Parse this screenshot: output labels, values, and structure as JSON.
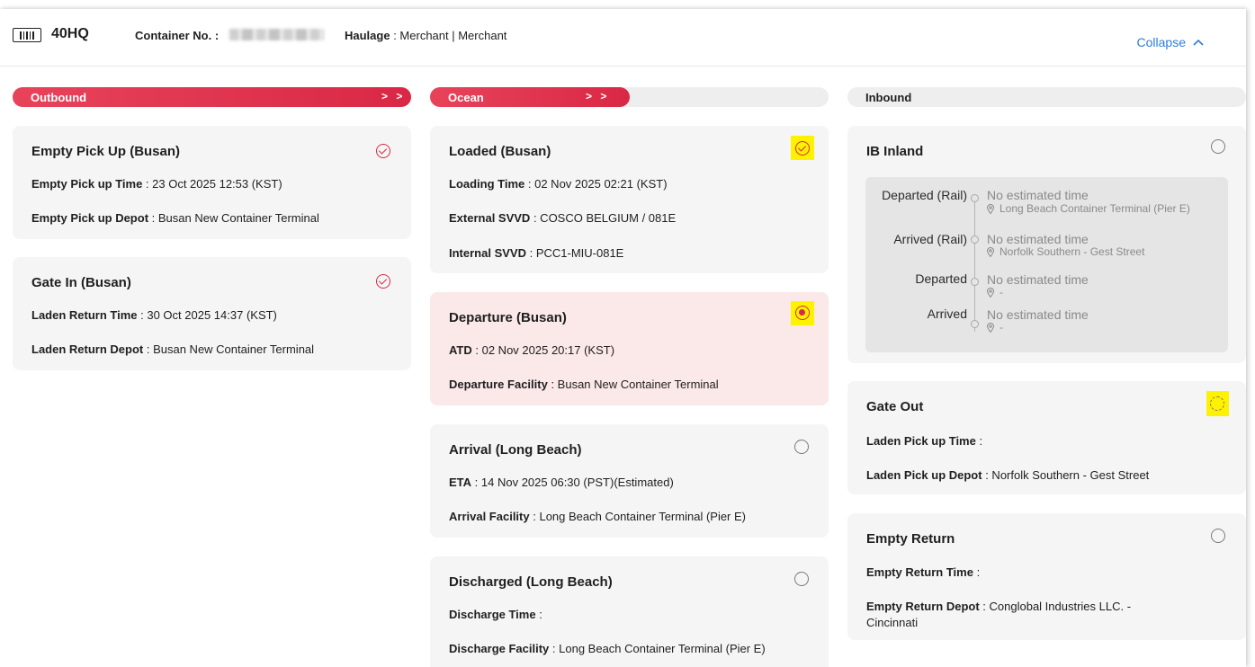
{
  "header": {
    "container_type": "40HQ",
    "container_no_label": "Container No. :",
    "haulage_label": "Haulage",
    "haulage_value": ": Merchant | Merchant",
    "collapse_label": "Collapse"
  },
  "phases": {
    "outbound": {
      "label": "Outbound",
      "arrows": "> >",
      "progress": 1.0
    },
    "ocean": {
      "label": "Ocean",
      "arrows": "> >",
      "progress": 0.5
    },
    "inbound": {
      "label": "Inbound",
      "progress": 0.0
    }
  },
  "outbound": {
    "empty_pickup": {
      "title": "Empty Pick Up (Busan)",
      "status": "completed",
      "time_label": "Empty Pick up Time",
      "time_value": ": 23 Oct 2025 12:53 (KST)",
      "depot_label": "Empty Pick up Depot",
      "depot_value": ": Busan New Container Terminal"
    },
    "gate_in": {
      "title": "Gate In (Busan)",
      "status": "completed",
      "time_label": "Laden Return Time",
      "time_value": ": 30 Oct 2025 14:37 (KST)",
      "depot_label": "Laden Return Depot",
      "depot_value": ": Busan New Container Terminal"
    }
  },
  "ocean": {
    "loaded": {
      "title": "Loaded (Busan)",
      "status": "completed",
      "time_label": "Loading Time",
      "time_value": ": 02 Nov 2025 02:21 (KST)",
      "ext_label": "External SVVD",
      "ext_value": ": COSCO BELGIUM / 081E",
      "int_label": "Internal SVVD",
      "int_value": ": PCC1-MIU-081E"
    },
    "departure": {
      "title": "Departure (Busan)",
      "status": "current",
      "atd_label": "ATD",
      "atd_value": ": 02 Nov 2025 20:17 (KST)",
      "facility_label": "Departure Facility",
      "facility_value": ": Busan New Container Terminal"
    },
    "arrival": {
      "title": "Arrival (Long Beach)",
      "status": "pending",
      "eta_label": "ETA",
      "eta_value": ": 14 Nov 2025 06:30 (PST)(Estimated)",
      "facility_label": "Arrival Facility",
      "facility_value": ": Long Beach Container Terminal (Pier E)"
    },
    "discharged": {
      "title": "Discharged (Long Beach)",
      "status": "pending",
      "time_label": "Discharge Time",
      "time_value": ":",
      "facility_label": "Discharge Facility",
      "facility_value": ": Long Beach Container Terminal (Pier E)"
    }
  },
  "inbound": {
    "ib_inland": {
      "title": "IB Inland",
      "status": "pending",
      "events": [
        {
          "label": "Departed (Rail)",
          "time": "No estimated time",
          "place": "Long Beach Container Terminal (Pier E)"
        },
        {
          "label": "Arrived (Rail)",
          "time": "No estimated time",
          "place": "Norfolk Southern - Gest Street"
        },
        {
          "label": "Departed",
          "time": "No estimated time",
          "place": "-"
        },
        {
          "label": "Arrived",
          "time": "No estimated time",
          "place": "-"
        }
      ]
    },
    "gate_out": {
      "title": "Gate Out",
      "status": "pending",
      "time_label": "Laden Pick up Time",
      "time_value": ":",
      "depot_label": "Laden Pick up Depot",
      "depot_value": ": Norfolk Southern - Gest Street"
    },
    "empty_return": {
      "title": "Empty Return",
      "status": "pending",
      "time_label": "Empty Return Time",
      "time_value": ":",
      "depot_label": "Empty Return Depot",
      "depot_value": ": Conglobal Industries LLC. -",
      "depot_value_2": "Cincinnati"
    }
  },
  "colors": {
    "accent_red": "#d92845",
    "link_blue": "#2a7de1",
    "card_bg": "#f5f5f5",
    "active_card_bg": "#fbe8e8",
    "highlight": "#fff200"
  },
  "icons": [
    "container-icon",
    "chevron-up-icon",
    "check-circle-icon",
    "radio-active-icon",
    "empty-circle-icon",
    "location-pin-icon"
  ]
}
